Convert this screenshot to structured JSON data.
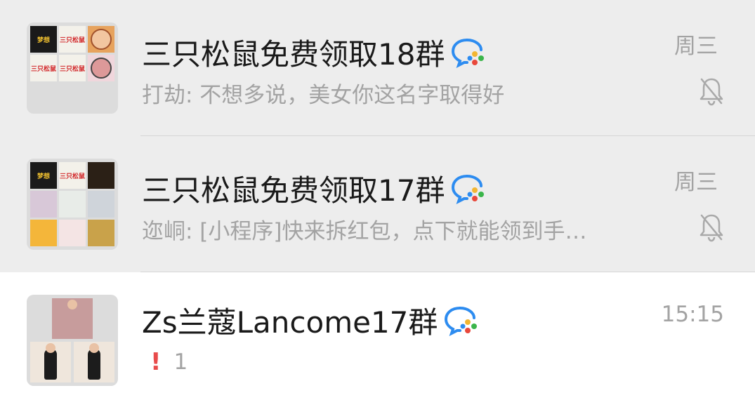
{
  "chats": [
    {
      "title": "三只松鼠免费领取18群",
      "preview": "打劫: 不想多说，美女你这名字取得好",
      "time": "周三",
      "muted": true,
      "pinned": true,
      "avatar_tiles": [
        "梦想",
        "三只松鼠",
        "",
        "",
        "三只松鼠",
        "三只松鼠",
        "",
        "",
        ""
      ]
    },
    {
      "title": "三只松鼠免费领取17群",
      "preview": "迩峒: [小程序]快来拆红包，点下就能领到手…",
      "time": "周三",
      "muted": true,
      "pinned": true,
      "avatar_tiles": [
        "梦想",
        "三只松鼠",
        "",
        "",
        "",
        "",
        "",
        "",
        ""
      ]
    },
    {
      "title": "Zs兰蔻Lancome17群",
      "alert_icon": "!",
      "preview": "1",
      "time": "15:15",
      "muted": false,
      "pinned": false
    }
  ],
  "colors": {
    "pinned_bg": "#ededed",
    "normal_bg": "#ffffff",
    "title": "#1a1a1a",
    "secondary": "#a3a3a3",
    "alert": "#e84b4b",
    "wecom_blue": "#2d8cf0"
  },
  "icons": {
    "group_badge": "wecom-group-icon",
    "mute": "bell-muted-icon"
  }
}
